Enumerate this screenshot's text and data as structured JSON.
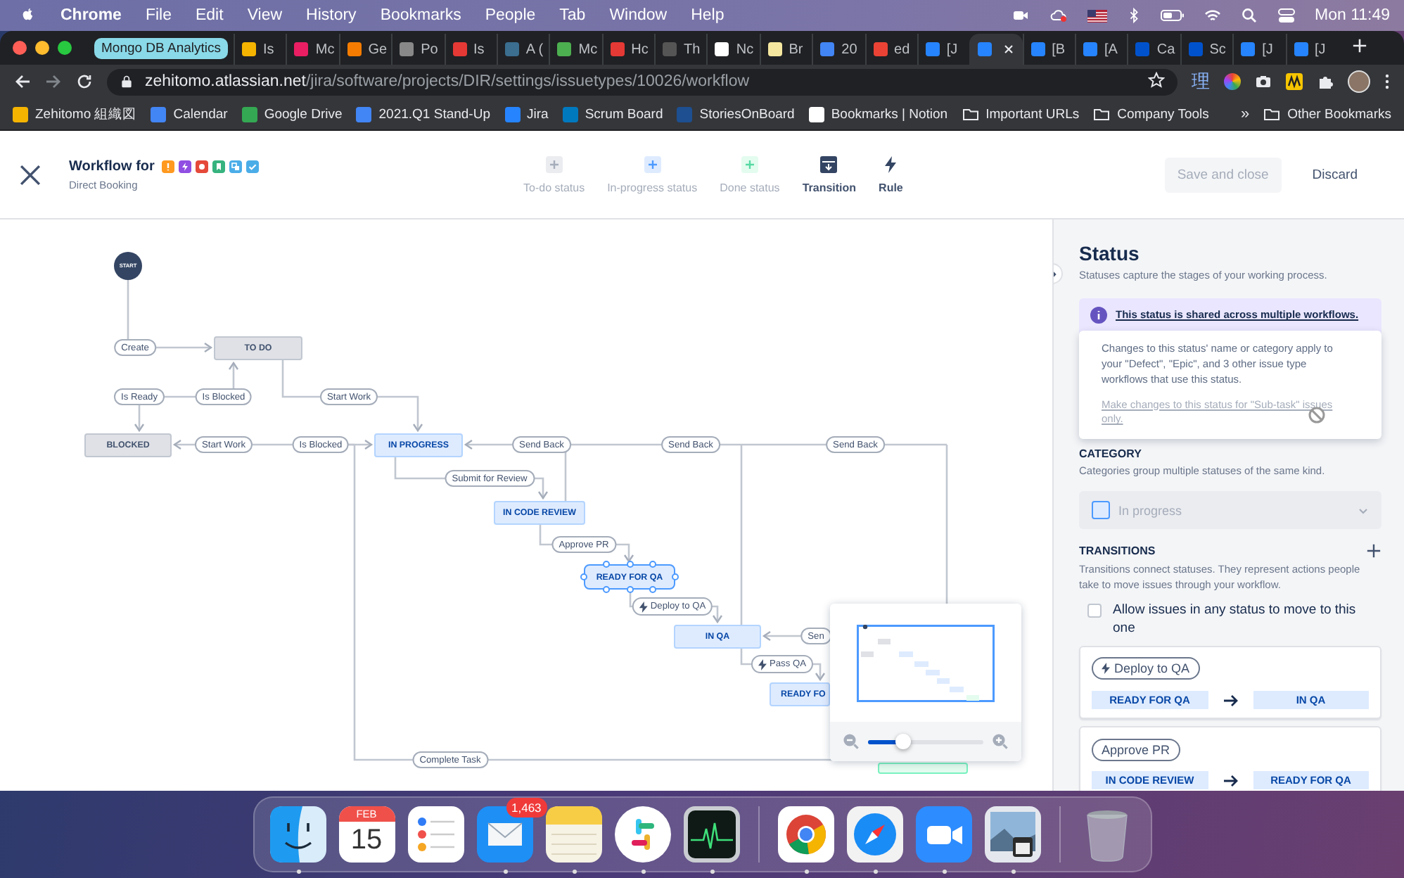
{
  "menubar": {
    "app": "Chrome",
    "menus": [
      "File",
      "Edit",
      "View",
      "History",
      "Bookmarks",
      "People",
      "Tab",
      "Window",
      "Help"
    ],
    "clock": "Mon 11:49"
  },
  "browser": {
    "tab_group": "Mongo DB Analytics",
    "tabs": [
      {
        "title": "Is",
        "color": "#f4b400",
        "selected": false
      },
      {
        "title": "Mc",
        "color": "#e91e63",
        "selected": false
      },
      {
        "title": "Ge",
        "color": "#f57c00",
        "selected": false
      },
      {
        "title": "Po",
        "color": "#888888",
        "selected": false
      },
      {
        "title": "Is",
        "color": "#e53935",
        "selected": false
      },
      {
        "title": "A (",
        "color": "#3b6e8f",
        "selected": false
      },
      {
        "title": "Mc",
        "color": "#4caf50",
        "selected": false
      },
      {
        "title": "Hc",
        "color": "#e53935",
        "selected": false
      },
      {
        "title": "Th",
        "color": "#555555",
        "selected": false
      },
      {
        "title": "Nc",
        "color": "#ffffff",
        "selected": false
      },
      {
        "title": "Br",
        "color": "#f5e7a0",
        "selected": false
      },
      {
        "title": "20",
        "color": "#4285f4",
        "selected": false
      },
      {
        "title": "ed",
        "color": "#ea4335",
        "selected": false
      },
      {
        "title": "[J",
        "color": "#2684ff",
        "selected": false
      },
      {
        "color": "#2684ff",
        "selected": true
      },
      {
        "title": "[B",
        "color": "#2684ff",
        "selected": false
      },
      {
        "title": "[A",
        "color": "#2684ff",
        "selected": false
      },
      {
        "title": "Ca",
        "color": "#0052cc",
        "selected": false
      },
      {
        "title": "Sc",
        "color": "#0052cc",
        "selected": false
      },
      {
        "title": "[J",
        "color": "#2684ff",
        "selected": false
      },
      {
        "title": "[J",
        "color": "#2684ff",
        "selected": false
      }
    ],
    "url": {
      "host": "zehitomo.atlassian.net",
      "path": "/jira/software/projects/DIR/settings/issuetypes/10026/workflow"
    },
    "extension_text": "理",
    "bookmarks": [
      {
        "label": "Zehitomo 組織図",
        "kind": "page",
        "color": "#f4b400"
      },
      {
        "label": "Calendar",
        "kind": "page",
        "color": "#4285f4"
      },
      {
        "label": "Google Drive",
        "kind": "page",
        "color": "#34a853"
      },
      {
        "label": "2021.Q1 Stand-Up",
        "kind": "page",
        "color": "#4285f4"
      },
      {
        "label": "Jira",
        "kind": "page",
        "color": "#2684ff"
      },
      {
        "label": "Scrum Board",
        "kind": "page",
        "color": "#0079bf"
      },
      {
        "label": "StoriesOnBoard",
        "kind": "page",
        "color": "#1d4f91"
      },
      {
        "label": "Bookmarks | Notion",
        "kind": "page",
        "color": "#ffffff"
      },
      {
        "label": "Important URLs",
        "kind": "folder"
      },
      {
        "label": "Company Tools",
        "kind": "folder"
      }
    ],
    "overflow": "»",
    "other_bookmarks": "Other Bookmarks"
  },
  "header": {
    "title": "Workflow for",
    "subtitle": "Direct Booking",
    "issue_types": [
      {
        "color": "#ff991f"
      },
      {
        "color": "#904ee2"
      },
      {
        "color": "#e5493a"
      },
      {
        "color": "#36b37e"
      },
      {
        "color": "#4bade8"
      },
      {
        "color": "#4bade8"
      }
    ],
    "tools": [
      {
        "label": "To-do status",
        "disabled": true
      },
      {
        "label": "In-progress status",
        "disabled": true
      },
      {
        "label": "Done status",
        "disabled": true
      },
      {
        "label": "Transition",
        "disabled": false
      },
      {
        "label": "Rule",
        "disabled": false
      }
    ],
    "buttons": [
      {
        "label": "Save and close",
        "disabled": true
      },
      {
        "label": "Discard",
        "disabled": false
      }
    ]
  },
  "diagram": {
    "start": "START",
    "statuses": [
      {
        "label": "TO DO",
        "kind": "todo",
        "selected": false
      },
      {
        "label": "BLOCKED",
        "kind": "todo",
        "selected": false
      },
      {
        "label": "IN PROGRESS",
        "kind": "in_progress",
        "selected": false
      },
      {
        "label": "IN CODE REVIEW",
        "kind": "in_progress",
        "selected": false
      },
      {
        "label": "READY FOR QA",
        "kind": "in_progress",
        "selected": true
      },
      {
        "label": "IN QA",
        "kind": "in_progress",
        "selected": false
      },
      {
        "label": "READY FO",
        "kind": "in_progress",
        "selected": false
      },
      {
        "kind": "done",
        "selected": false
      }
    ],
    "transitions": [
      {
        "label": "Create",
        "kind": "plain"
      },
      {
        "label": "Is Ready",
        "kind": "plain"
      },
      {
        "label": "Is Blocked",
        "kind": "plain"
      },
      {
        "label": "Start Work",
        "kind": "plain"
      },
      {
        "label": "Start Work",
        "kind": "plain"
      },
      {
        "label": "Is Blocked",
        "kind": "plain"
      },
      {
        "label": "Send Back",
        "kind": "plain"
      },
      {
        "label": "Send Back",
        "kind": "plain"
      },
      {
        "label": "Send Back",
        "kind": "plain"
      },
      {
        "label": "Submit for Review",
        "kind": "plain"
      },
      {
        "label": "Approve PR",
        "kind": "plain"
      },
      {
        "label": "Deploy to QA",
        "kind": "rule"
      },
      {
        "label": "Sen",
        "kind": "plain"
      },
      {
        "label": "Pass QA",
        "kind": "rule"
      },
      {
        "label": "Complete Task",
        "kind": "plain"
      }
    ]
  },
  "minimap": {
    "zoom": {
      "level": 0.3
    }
  },
  "panel": {
    "title": "Status",
    "description": "Statuses capture the stages of your working process.",
    "notice": "This status is shared across multiple workflows.",
    "popover": {
      "text": "Changes to this status' name or category apply to your \"Defect\", \"Epic\", and 3 other issue type workflows that use this status.",
      "link": "Make changes to this status for \"Sub-task\" issues only."
    },
    "category": {
      "heading": "CATEGORY",
      "description": "Categories group multiple statuses of the same kind.",
      "value": "In progress",
      "disabled": true
    },
    "transitions": {
      "heading": "TRANSITIONS",
      "description": "Transitions connect statuses. They represent actions people take to move issues through your workflow.",
      "allow_any": {
        "label": "Allow issues in any status to move to this one",
        "checked": false
      },
      "items": [
        {
          "name": "Deploy to QA",
          "kind": "rule",
          "from": "READY FOR QA",
          "to": "IN QA"
        },
        {
          "name": "Approve PR",
          "kind": "plain",
          "from": "IN CODE REVIEW",
          "to": "READY FOR QA"
        }
      ]
    }
  },
  "dock": {
    "apps": [
      {
        "running": true
      },
      {
        "month": "FEB",
        "day": "15",
        "running": false
      },
      {
        "running": false
      },
      {
        "badge": "1,463",
        "running": true
      },
      {
        "running": true
      },
      {
        "running": true
      },
      {
        "running": true
      },
      {
        "running": true
      },
      {
        "running": true
      },
      {
        "running": true
      },
      {
        "running": true
      }
    ]
  }
}
